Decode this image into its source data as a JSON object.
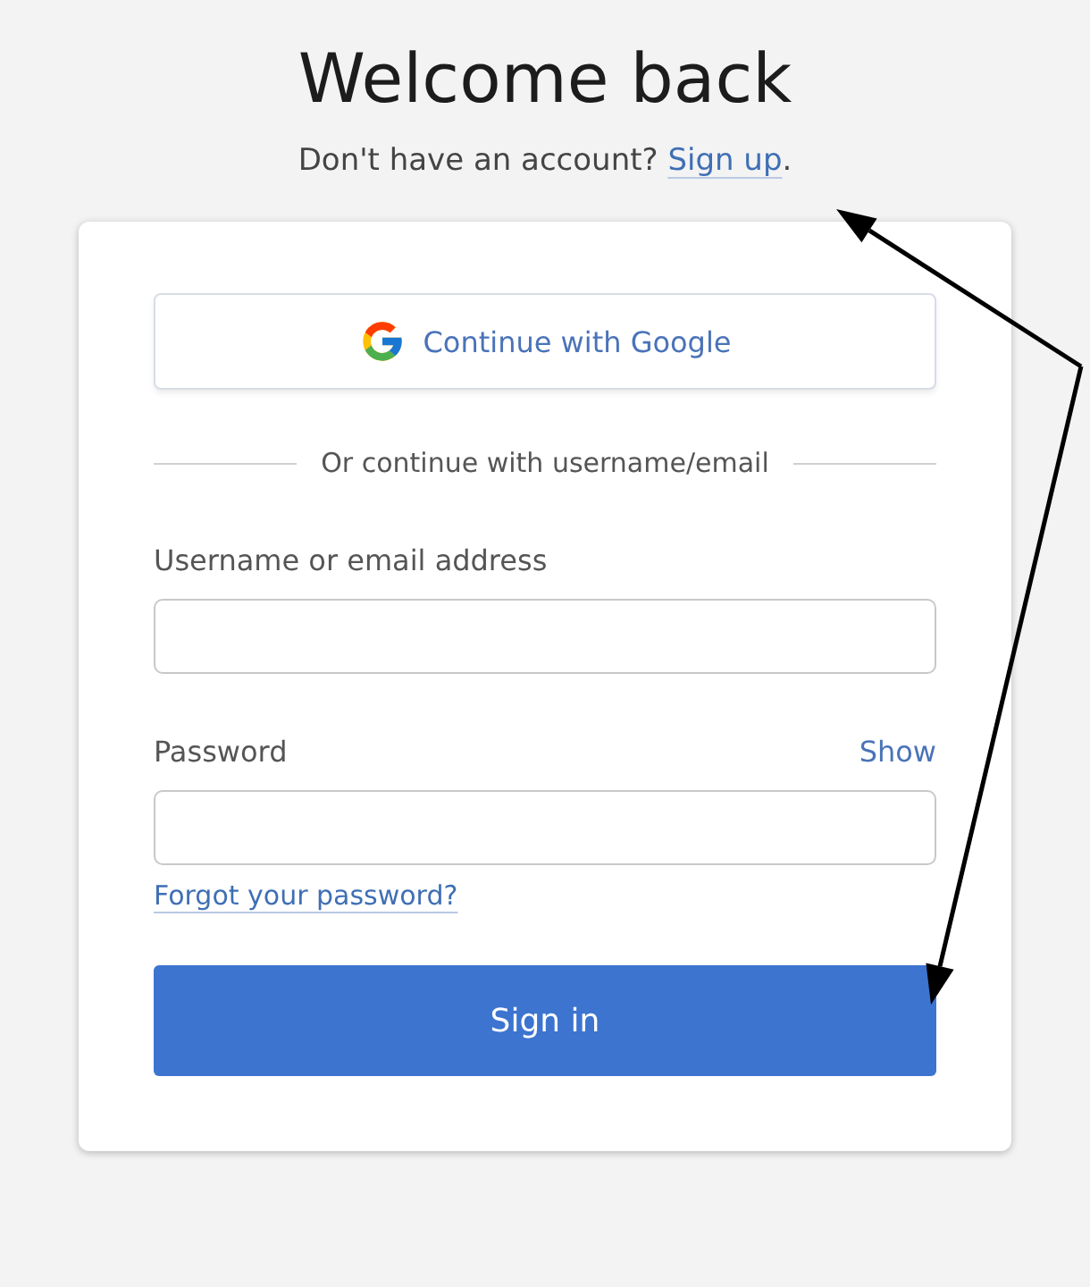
{
  "heading": "Welcome back",
  "signup_prompt": {
    "text": "Don't have an account?",
    "link": "Sign up",
    "trailing": "."
  },
  "google_button": {
    "label": "Continue with Google"
  },
  "divider": "Or continue with username/email",
  "fields": [
    {
      "label": "Username or email address"
    },
    {
      "label": "Password",
      "action": "Show"
    }
  ],
  "forgot_link": "Forgot your password?",
  "submit": "Sign in"
}
